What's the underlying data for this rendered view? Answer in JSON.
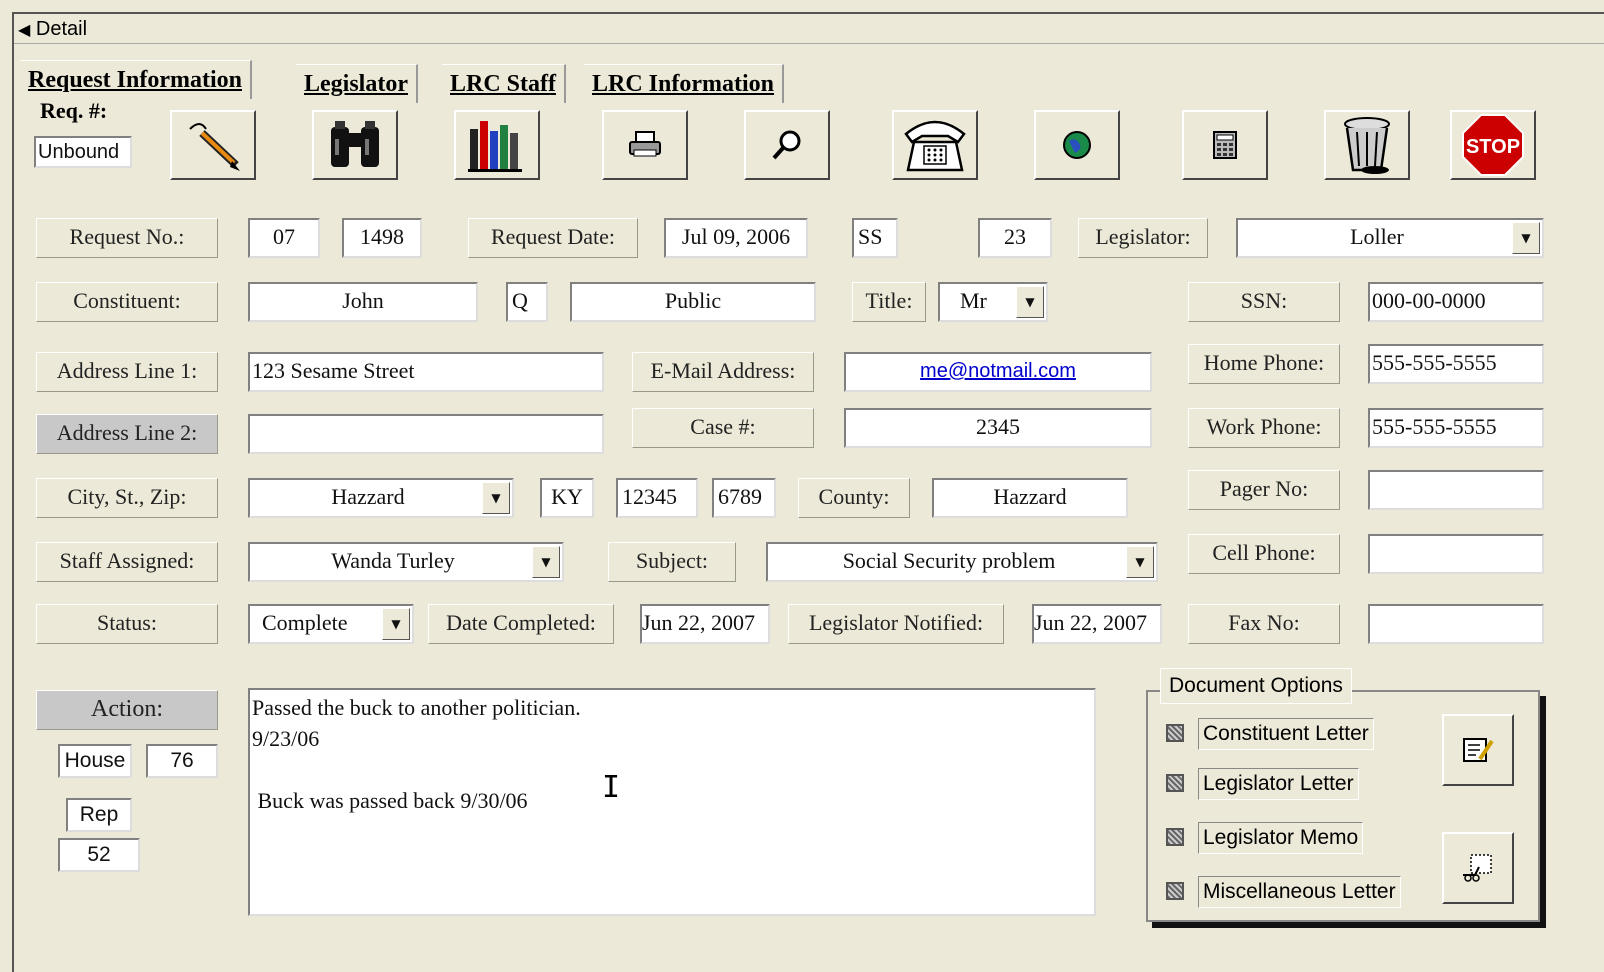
{
  "window": {
    "title": "Detail"
  },
  "tabs": [
    {
      "label": "Request Information"
    },
    {
      "label": "Legislator"
    },
    {
      "label": "LRC Staff"
    },
    {
      "label": "LRC Information"
    }
  ],
  "req": {
    "label": "Req. #:",
    "value": "Unbound"
  },
  "toolbar": [
    {
      "icon": "pen-icon"
    },
    {
      "icon": "binoculars-icon"
    },
    {
      "icon": "books-icon"
    },
    {
      "icon": "printer-icon"
    },
    {
      "icon": "magnifier-icon"
    },
    {
      "icon": "telephone-icon"
    },
    {
      "icon": "globe-icon"
    },
    {
      "icon": "calculator-icon"
    },
    {
      "icon": "trash-icon"
    },
    {
      "icon": "stop-icon",
      "text": "STOP"
    }
  ],
  "form": {
    "request_no": {
      "label": "Request No.:",
      "part1": "07",
      "part2": "1498"
    },
    "request_date": {
      "label": "Request Date:",
      "value": "Jul 09, 2006"
    },
    "ss": {
      "value": "SS"
    },
    "district": {
      "value": "23"
    },
    "legislator": {
      "label": "Legislator:",
      "value": "Loller"
    },
    "constituent": {
      "label": "Constituent:",
      "first": "John",
      "middle": "Q",
      "last": "Public"
    },
    "title": {
      "label": "Title:",
      "value": "Mr"
    },
    "ssn": {
      "label": "SSN:",
      "value": "000-00-0000"
    },
    "address1": {
      "label": "Address Line 1:",
      "value": "123 Sesame Street"
    },
    "email": {
      "label": "E-Mail Address:",
      "value": "me@notmail.com"
    },
    "home_phone": {
      "label": "Home Phone:",
      "value": "555-555-5555"
    },
    "address2": {
      "label": "Address Line 2:",
      "value": ""
    },
    "case": {
      "label": "Case #:",
      "value": "2345"
    },
    "work_phone": {
      "label": "Work Phone:",
      "value": "555-555-5555"
    },
    "city": {
      "label": "City, St., Zip:",
      "city": "Hazzard",
      "state": "KY",
      "zip": "12345",
      "zip4": "6789"
    },
    "county": {
      "label": "County:",
      "value": "Hazzard"
    },
    "pager": {
      "label": "Pager No:",
      "value": ""
    },
    "staff": {
      "label": "Staff Assigned:",
      "value": "Wanda Turley"
    },
    "subject": {
      "label": "Subject:",
      "value": "Social Security problem"
    },
    "cell": {
      "label": "Cell Phone:",
      "value": ""
    },
    "status": {
      "label": "Status:",
      "value": "Complete"
    },
    "date_completed": {
      "label": "Date Completed:",
      "value": "Jun 22, 2007"
    },
    "leg_notified": {
      "label": "Legislator Notified:",
      "value": "Jun 22, 2007"
    },
    "fax": {
      "label": "Fax No:",
      "value": ""
    },
    "action": {
      "label": "Action:",
      "chamber": "House",
      "chamber_no": "76",
      "role": "Rep",
      "role_no": "52",
      "text": "Passed the buck to another politician.\n9/23/06\n\n Buck was passed back 9/30/06"
    }
  },
  "document_options": {
    "title": "Document Options",
    "items": [
      {
        "label": "Constituent Letter"
      },
      {
        "label": "Legislator Letter"
      },
      {
        "label": "Legislator Memo"
      },
      {
        "label": "Miscellaneous Letter"
      }
    ]
  },
  "colors": {
    "background": "#ece9d8",
    "link": "#0000cc",
    "stop": "#cc0000"
  }
}
